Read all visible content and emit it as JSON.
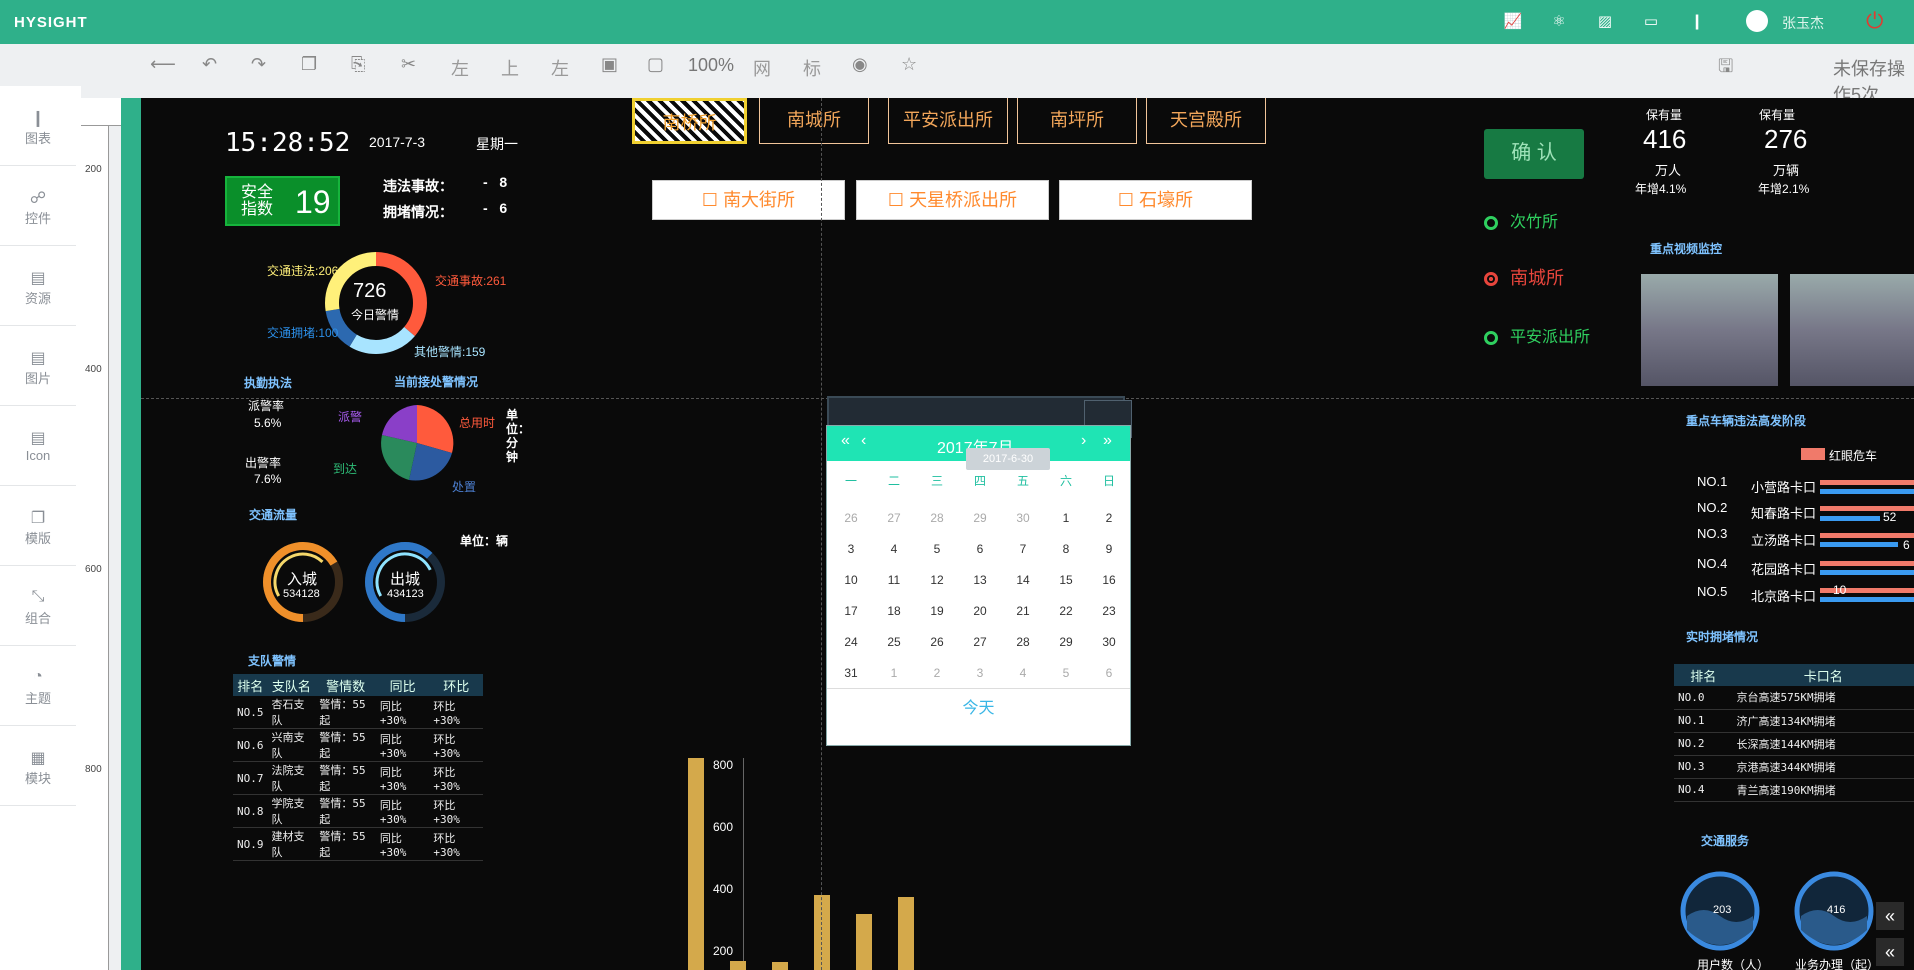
{
  "app": {
    "brand": "HYSIGHT",
    "user": "张玉杰"
  },
  "topbar_icons": [
    "chart-icon",
    "atom-icon",
    "puzzle-icon",
    "monitor-icon",
    "bars-icon"
  ],
  "toolbar": {
    "zoom": "100%",
    "grid": "网",
    "label": "标",
    "align_left": "左",
    "align_top": "上",
    "align_right": "左",
    "save_status": "未保存操作5次"
  },
  "sidebar": [
    {
      "label": "图表",
      "icon": "bar-chart-icon"
    },
    {
      "label": "控件",
      "icon": "control-icon"
    },
    {
      "label": "资源",
      "icon": "book-icon"
    },
    {
      "label": "图片",
      "icon": "image-icon"
    },
    {
      "label": "Icon",
      "icon": "icon-icon"
    },
    {
      "label": "模版",
      "icon": "template-icon"
    },
    {
      "label": "组合",
      "icon": "combine-icon"
    },
    {
      "label": "主题",
      "icon": "pie-icon"
    },
    {
      "label": "模块",
      "icon": "module-icon"
    }
  ],
  "ruler": {
    "ticks": [
      "200",
      "400",
      "600",
      "800"
    ]
  },
  "dashboard": {
    "time": "15:28:52",
    "date": "2017-7-3",
    "weekday": "星期一",
    "safety": {
      "label": "安全指数",
      "value": "19"
    },
    "stats": [
      {
        "label": "违法事故：",
        "value": "-   8"
      },
      {
        "label": "拥堵情况：",
        "value": "-   6"
      }
    ],
    "donut": {
      "center_value": "726",
      "center_label": "今日警情",
      "labels": {
        "illegal": "交通违法:206",
        "accident": "交通事故:261",
        "jam": "交通拥堵:100",
        "other": "其他警情:159"
      }
    },
    "dispatch_title": "执勤执法",
    "handling_title": "当前接处警情况",
    "dispatch_rate_label": "派警率",
    "dispatch_rate": "5.6%",
    "out_rate_label": "出警率",
    "out_rate": "7.6%",
    "pie_labels": {
      "dispatch": "派警",
      "arrive": "到达",
      "total": "总用时",
      "handle": "处置"
    },
    "unit_minute": "单位：分钟",
    "traffic_title": "交通流量",
    "traffic_unit": "单位：辆",
    "gauge_in": {
      "label": "入城",
      "value": "534128"
    },
    "gauge_out": {
      "label": "出城",
      "value": "434123"
    },
    "team_title": "支队警情",
    "team_table": {
      "headers": [
        "排名",
        "支队名",
        "警情数",
        "同比",
        "环比"
      ],
      "rows": [
        [
          "NO.5",
          "杏石支队",
          "警情：55起",
          "同比+30%",
          "环比+30%"
        ],
        [
          "NO.6",
          "兴南支队",
          "警情：55起",
          "同比+30%",
          "环比+30%"
        ],
        [
          "NO.7",
          "法院支队",
          "警情：55起",
          "同比+30%",
          "环比+30%"
        ],
        [
          "NO.8",
          "学院支队",
          "警情：55起",
          "同比+30%",
          "环比+30%"
        ],
        [
          "NO.9",
          "建材支队",
          "警情：55起",
          "同比+30%",
          "环比+30%"
        ]
      ]
    },
    "stations": [
      "南桥所",
      "南城所",
      "平安派出所",
      "南坪所",
      "天宫殿所"
    ],
    "station_buttons": [
      "南大街所",
      "天星桥派出所",
      "石壕所"
    ],
    "confirm": "确 认",
    "radios": [
      {
        "label": "次竹所",
        "selected": false,
        "color": "#2fd05f"
      },
      {
        "label": "南城所",
        "selected": true,
        "color": "#e8453c"
      },
      {
        "label": "平安派出所",
        "selected": false,
        "color": "#2fd05f"
      }
    ],
    "kpis": [
      {
        "top": "保有量",
        "value": "416",
        "unit": "万人",
        "rate": "年增4.1%"
      },
      {
        "top": "保有量",
        "value": "276",
        "unit": "万辆",
        "rate": "年增2.1%"
      }
    ],
    "video_title": "重点视频监控",
    "rank_title": "重点车辆违法高发阶段",
    "rank_legend": "红眼危车",
    "ranks": [
      {
        "no": "NO.1",
        "name": "小营路卡口"
      },
      {
        "no": "NO.2",
        "name": "知春路卡口",
        "v": "52"
      },
      {
        "no": "NO.3",
        "name": "立汤路卡口",
        "v": "6"
      },
      {
        "no": "NO.4",
        "name": "花园路卡口"
      },
      {
        "no": "NO.5",
        "name": "北京路卡口",
        "v": "10"
      }
    ],
    "jam_title": "实时拥堵情况",
    "jam_table": {
      "headers": [
        "排名",
        "卡口名"
      ],
      "rows": [
        [
          "NO.0",
          "京台高速575KM拥堵"
        ],
        [
          "NO.1",
          "济广高速134KM拥堵"
        ],
        [
          "NO.2",
          "长深高速144KM拥堵"
        ],
        [
          "NO.3",
          "京港高速344KM拥堵"
        ],
        [
          "NO.4",
          "青兰高速190KM拥堵"
        ]
      ]
    },
    "service_title": "交通服务",
    "service": [
      {
        "value": "203",
        "label": "用户数（人）"
      },
      {
        "value": "416",
        "label": "业务办理（起）"
      }
    ]
  },
  "datepicker": {
    "title": "2017年7月",
    "tooltip": "2017-6-30",
    "weekdays": [
      "一",
      "二",
      "三",
      "四",
      "五",
      "六",
      "日"
    ],
    "days": [
      [
        "26",
        "27",
        "28",
        "29",
        "30",
        "1",
        "2"
      ],
      [
        "3",
        "4",
        "5",
        "6",
        "7",
        "8",
        "9"
      ],
      [
        "10",
        "11",
        "12",
        "13",
        "14",
        "15",
        "16"
      ],
      [
        "17",
        "18",
        "19",
        "20",
        "21",
        "22",
        "23"
      ],
      [
        "24",
        "25",
        "26",
        "27",
        "28",
        "29",
        "30"
      ],
      [
        "31",
        "1",
        "2",
        "3",
        "4",
        "5",
        "6"
      ]
    ],
    "today": "今天"
  },
  "chart_data": {
    "type": "bar",
    "yticks": [
      "800",
      "600",
      "400",
      "200"
    ],
    "values": [
      830,
      180,
      175,
      390,
      330,
      385
    ],
    "ylim": [
      150,
      830
    ]
  }
}
